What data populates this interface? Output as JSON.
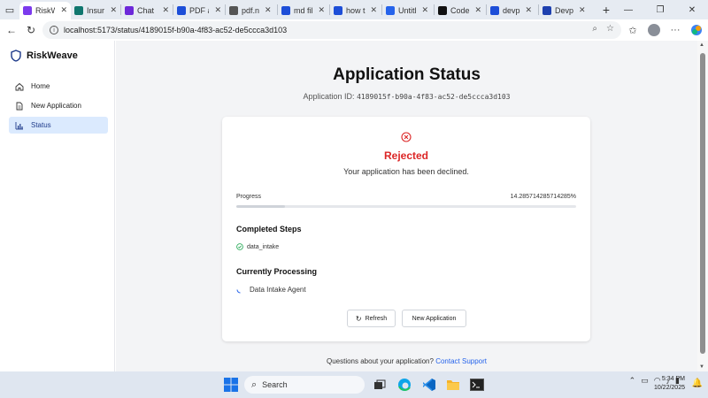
{
  "browser": {
    "tabs": [
      {
        "label": "RiskW",
        "color": "#7c3aed",
        "icon": "riskweave-favicon",
        "active": true
      },
      {
        "label": "Insura",
        "color": "#0f766e",
        "icon": "insurance-favicon"
      },
      {
        "label": "Chat |",
        "color": "#6d28d9",
        "icon": "chat-favicon"
      },
      {
        "label": "PDF a",
        "color": "#1d4ed8",
        "icon": "search-favicon"
      },
      {
        "label": "pdf.n",
        "color": "#555555",
        "icon": "pdf-favicon"
      },
      {
        "label": "md fil",
        "color": "#1d4ed8",
        "icon": "search-favicon"
      },
      {
        "label": "how t",
        "color": "#1d4ed8",
        "icon": "search-favicon"
      },
      {
        "label": "Untitl",
        "color": "#2563eb",
        "icon": "doc-favicon"
      },
      {
        "label": "Code",
        "color": "#111111",
        "icon": "github-favicon"
      },
      {
        "label": "devp",
        "color": "#1d4ed8",
        "icon": "search-favicon"
      },
      {
        "label": "Devp",
        "color": "#1e40af",
        "icon": "devpost-favicon"
      }
    ],
    "url": "localhost:5173/status/4189015f-b90a-4f83-ac52-de5ccca3d103"
  },
  "sidebar": {
    "brand": "RiskWeave",
    "items": [
      {
        "label": "Home",
        "icon": "home-icon"
      },
      {
        "label": "New Application",
        "icon": "document-icon"
      },
      {
        "label": "Status",
        "icon": "bar-chart-icon",
        "active": true
      }
    ]
  },
  "main": {
    "title": "Application Status",
    "app_id_label": "Application ID:",
    "app_id": "4189015f-b90a-4f83-ac52-de5ccca3d103",
    "status_title": "Rejected",
    "status_message": "Your application has been declined.",
    "progress_label": "Progress",
    "progress_value": "14.285714285714285%",
    "progress_fraction": 0.14285714285714285,
    "completed_heading": "Completed Steps",
    "completed_steps": [
      "data_intake"
    ],
    "processing_heading": "Currently Processing",
    "processing_item": "Data Intake Agent",
    "refresh_label": "Refresh",
    "new_app_label": "New Application",
    "footer_text": "Questions about your application?",
    "footer_link": "Contact Support"
  },
  "taskbar": {
    "search_placeholder": "Search",
    "time": "5:34 PM",
    "date": "10/22/2025"
  },
  "colors": {
    "accent": "#2563eb",
    "rejected": "#dc2626",
    "success": "#16a34a",
    "active_nav_bg": "#dbeafe"
  }
}
